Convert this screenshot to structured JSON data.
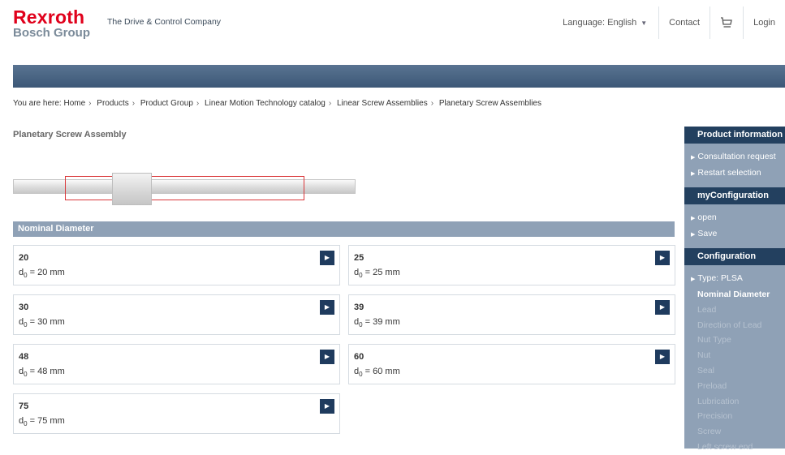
{
  "brand": {
    "name": "Rexroth",
    "group": "Bosch Group",
    "tagline": "The Drive & Control Company",
    "color": "#e0001b"
  },
  "header": {
    "language_label": "Language: English",
    "contact": "Contact",
    "login": "Login"
  },
  "breadcrumb": {
    "prefix": "You are here:",
    "items": [
      "Home",
      "Products",
      "Product Group",
      "Linear Motion Technology catalog",
      "Linear Screw Assemblies",
      "Planetary Screw Assemblies"
    ]
  },
  "main": {
    "title": "Planetary Screw Assembly",
    "section_title": "Nominal Diameter",
    "options": [
      {
        "value": "20",
        "desc": "20 mm"
      },
      {
        "value": "25",
        "desc": "25 mm"
      },
      {
        "value": "30",
        "desc": "30 mm"
      },
      {
        "value": "39",
        "desc": "39 mm"
      },
      {
        "value": "48",
        "desc": "48 mm"
      },
      {
        "value": "60",
        "desc": "60 mm"
      },
      {
        "value": "75",
        "desc": "75 mm"
      }
    ],
    "symbol": "d",
    "subscript": "0",
    "equals": " = "
  },
  "sidebar": {
    "product_info_title": "Product information",
    "product_info_items": [
      "Consultation request",
      "Restart selection"
    ],
    "myconfig_title": "myConfiguration",
    "myconfig_items": [
      "open",
      "Save"
    ],
    "config_title": "Configuration",
    "config_type": "Type: PLSA",
    "steps": [
      "Nominal Diameter",
      "Lead",
      "Direction of Lead",
      "Nut Type",
      "Nut",
      "Seal",
      "Preload",
      "Lubrication",
      "Precision",
      "Screw",
      "Left screw end"
    ],
    "active_step": "Nominal Diameter"
  },
  "colors": {
    "dark_blue": "#23405f",
    "panel_blue": "#8fa1b6",
    "bar_blue": "#4a6584",
    "highlight_red": "#d9373a"
  }
}
